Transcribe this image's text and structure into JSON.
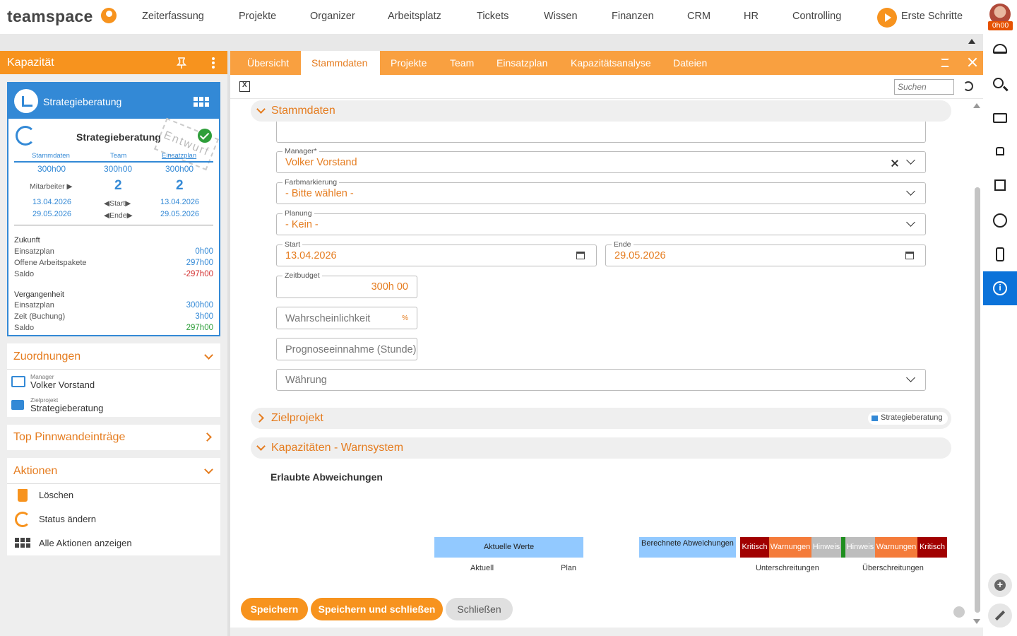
{
  "app": {
    "logo": "teamspace",
    "nav": [
      "Zeiterfassung",
      "Projekte",
      "Organizer",
      "Arbeitsplatz",
      "Tickets",
      "Wissen",
      "Finanzen",
      "CRM",
      "HR",
      "Controlling"
    ],
    "first_steps": "Erste Schritte",
    "user_time": "0h00"
  },
  "left": {
    "title": "Kapazität",
    "card": {
      "header_name": "Strategieberatung",
      "title": "Strategieberatung",
      "stamp": "Entwurf",
      "cols": [
        "Stammdaten",
        "Team",
        "Einsatzplan"
      ],
      "totals": [
        "300h00",
        "300h00",
        "300h00"
      ],
      "mitarbeiter_label": "Mitarbeiter ▶",
      "count_team": "2",
      "count_plan": "2",
      "start_date": "13.04.2026",
      "end_date": "29.05.2026",
      "start_label": "◀Start▶",
      "end_label": "◀Ende▶",
      "plan_start": "13.04.2026",
      "plan_end": "29.05.2026",
      "zukunft": "Zukunft",
      "z_rows": [
        {
          "label": "Einsatzplan",
          "value": "0h00"
        },
        {
          "label": "Offene Arbeitspakete",
          "value": "297h00"
        },
        {
          "label": "Saldo",
          "value": "-297h00"
        }
      ],
      "vergangenheit": "Vergangenheit",
      "v_rows": [
        {
          "label": "Einsatzplan",
          "value": "300h00"
        },
        {
          "label": "Zeit (Buchung)",
          "value": "3h00"
        },
        {
          "label": "Saldo",
          "value": "297h00"
        }
      ]
    },
    "zuordnungen": {
      "title": "Zuordnungen",
      "manager_label": "Manager",
      "manager": "Volker Vorstand",
      "project_label": "Zielprojekt",
      "project": "Strategieberatung"
    },
    "pinwand": {
      "title": "Top Pinnwandeinträge"
    },
    "aktionen": {
      "title": "Aktionen",
      "items": [
        "Löschen",
        "Status ändern",
        "Alle Aktionen anzeigen"
      ]
    }
  },
  "tabs": [
    "Übersicht",
    "Stammdaten",
    "Projekte",
    "Team",
    "Einsatzplan",
    "Kapazitätsanalyse",
    "Dateien"
  ],
  "toolbar": {
    "search_placeholder": "Suchen"
  },
  "form": {
    "section_stammdaten": "Stammdaten",
    "manager_label": "Manager*",
    "manager_value": "Volker Vorstand",
    "farb_label": "Farbmarkierung",
    "farb_value": "- Bitte wählen -",
    "planung_label": "Planung",
    "planung_value": "- Kein -",
    "start_label": "Start",
    "start_value": "13.04.2026",
    "ende_label": "Ende",
    "ende_value": "29.05.2026",
    "budget_label": "Zeitbudget",
    "budget_value": "300h 00",
    "wahrsch_placeholder": "Wahrscheinlichkeit",
    "wahrsch_unit": "%",
    "prognose_placeholder": "Prognoseeinnahme (Stunde)",
    "waehrung_placeholder": "Währung",
    "section_zielprojekt": "Zielprojekt",
    "zielprojekt_badge": "Strategieberatung",
    "section_warnsystem": "Kapazitäten - Warnsystem",
    "erlaubte": "Erlaubte Abweichungen",
    "aktuelle_werte": "Aktuelle Werte",
    "berechnete": "Berechnete Abweichungen",
    "aktuell": "Aktuell",
    "plan": "Plan",
    "segments": [
      "Kritisch",
      "Warnungen",
      "Hinweis",
      "Hinweis",
      "Warnungen",
      "Kritisch"
    ],
    "unter": "Unterschreitungen",
    "ueber": "Überschreitungen"
  },
  "buttons": {
    "save": "Speichern",
    "save_close": "Speichern und schließen",
    "close": "Schließen"
  },
  "colors": {
    "orange": "#f7931e",
    "blue": "#3389d6",
    "rail_active": "#0b72d9",
    "critical": "#a10000",
    "warning": "#f47b3a",
    "hint": "#bdbdbd",
    "ok_marker": "#1e8e1e",
    "bar_blue": "#92c9ff"
  }
}
